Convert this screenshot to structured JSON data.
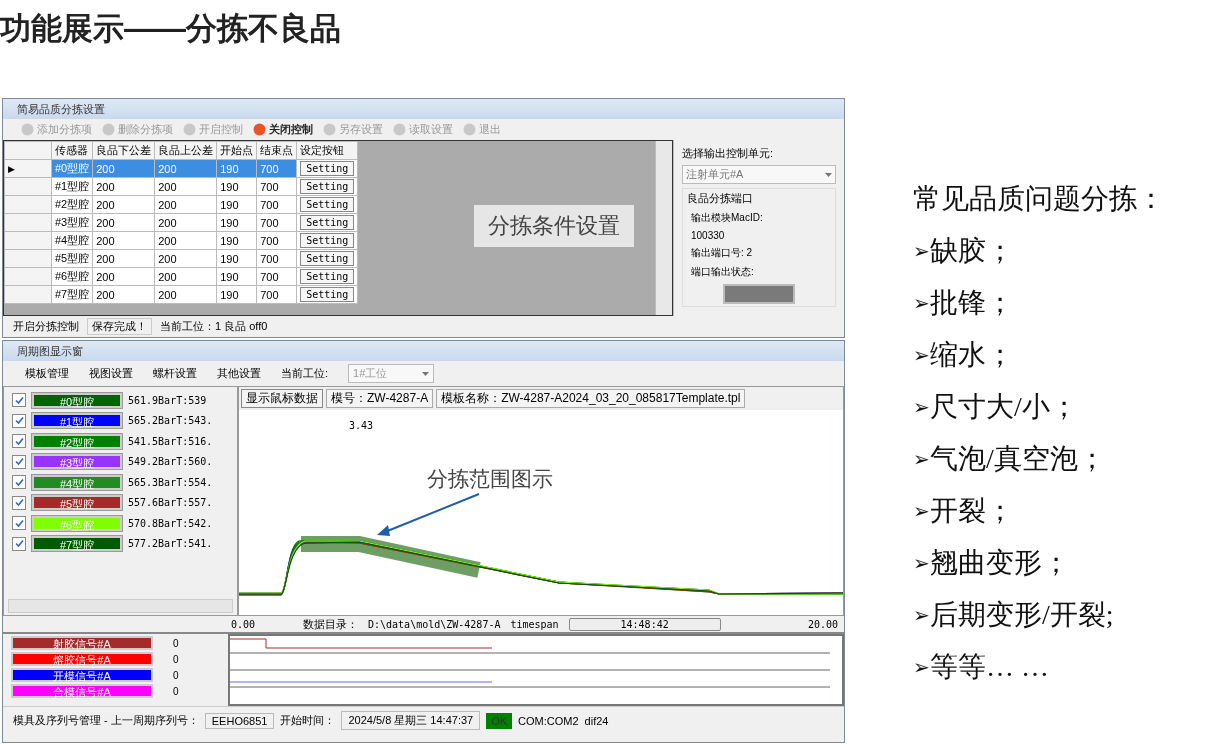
{
  "title": "功能展示——分拣不良品",
  "settings_window": {
    "title": "简易品质分拣设置",
    "toolbar": [
      {
        "label": "添加分拣项",
        "disabled": true
      },
      {
        "label": "删除分拣项",
        "disabled": true
      },
      {
        "label": "开启控制",
        "disabled": true
      },
      {
        "label": "关闭控制",
        "disabled": false
      },
      {
        "label": "另存设置",
        "disabled": true
      },
      {
        "label": "读取设置",
        "disabled": true
      },
      {
        "label": "退出",
        "disabled": true
      }
    ],
    "table": {
      "columns": [
        "传感器",
        "良品下公差",
        "良品上公差",
        "开始点",
        "结束点",
        "设定按钮"
      ],
      "rows": [
        {
          "selected": true,
          "current": "▶",
          "cells": [
            "#0型腔",
            "200",
            "200",
            "190",
            "700"
          ],
          "button": "Setting"
        },
        {
          "selected": false,
          "cells": [
            "#1型腔",
            "200",
            "200",
            "190",
            "700"
          ],
          "button": "Setting"
        },
        {
          "selected": false,
          "cells": [
            "#2型腔",
            "200",
            "200",
            "190",
            "700"
          ],
          "button": "Setting"
        },
        {
          "selected": false,
          "cells": [
            "#3型腔",
            "200",
            "200",
            "190",
            "700"
          ],
          "button": "Setting"
        },
        {
          "selected": false,
          "cells": [
            "#4型腔",
            "200",
            "200",
            "190",
            "700"
          ],
          "button": "Setting"
        },
        {
          "selected": false,
          "cells": [
            "#5型腔",
            "200",
            "200",
            "190",
            "700"
          ],
          "button": "Setting"
        },
        {
          "selected": false,
          "cells": [
            "#6型腔",
            "200",
            "200",
            "190",
            "700"
          ],
          "button": "Setting"
        },
        {
          "selected": false,
          "cells": [
            "#7型腔",
            "200",
            "200",
            "190",
            "700"
          ],
          "button": "Setting"
        }
      ]
    },
    "overlay_label": "分拣条件设置",
    "status": [
      "开启分拣控制",
      "保存完成！",
      "当前工位：1  良品  off0"
    ],
    "output_panel": {
      "heading": "选择输出控制单元:",
      "unit_select": "注射单元#A",
      "group_title": "良品分拣端口",
      "module_label": "输出模块MacID:",
      "module_value": "100330",
      "port_label": "输出端口号:  2",
      "state_label": "端口输出状态:"
    }
  },
  "monitor_window": {
    "title": "周期图显示窗",
    "menu": [
      "模板管理",
      "视图设置",
      "螺杆设置",
      "其他设置"
    ],
    "station_label": "当前工位:",
    "station_select": "1#工位",
    "cavities": [
      {
        "checked": true,
        "label": "#0型腔",
        "color": "#006400",
        "reading": "561.9BarT:539"
      },
      {
        "checked": true,
        "label": "#1型腔",
        "color": "#0000ff",
        "reading": "565.2BarT:543."
      },
      {
        "checked": true,
        "label": "#2型腔",
        "color": "#008000",
        "reading": "541.5BarT:516."
      },
      {
        "checked": true,
        "label": "#3型腔",
        "color": "#9933ff",
        "reading": "549.2BarT:560."
      },
      {
        "checked": true,
        "label": "#4型腔",
        "color": "#228b22",
        "reading": "565.3BarT:554."
      },
      {
        "checked": true,
        "label": "#5型腔",
        "color": "#a52a2a",
        "reading": "557.6BarT:557."
      },
      {
        "checked": true,
        "label": "#6型腔",
        "color": "#7fff00",
        "reading": "570.8BarT:542."
      },
      {
        "checked": true,
        "label": "#7型腔",
        "color": "#005a00",
        "reading": "577.2BarT:541."
      }
    ],
    "info_bar": [
      "显示鼠标数据",
      "模号：ZW-4287-A",
      "模板名称：ZW-4287-A2024_03_20_085817Template.tpl"
    ],
    "chart": {
      "cursor_value": "3.43",
      "annotation": "分拣范围图示"
    },
    "axis_bar": {
      "start": "0.00",
      "dir_label": "数据目录：",
      "dir_value": "D:\\data\\mold\\ZW-4287-A",
      "span_label": "timespan",
      "time": "14:48:42",
      "end": "20.00"
    },
    "signals": [
      {
        "label": "射胶信号#A",
        "color": "#a52a2a",
        "value": "0"
      },
      {
        "label": "熔胶信号#A",
        "color": "#ff0000",
        "value": "0"
      },
      {
        "label": "开模信号#A",
        "color": "#0000ff",
        "value": "0"
      },
      {
        "label": "合模信号#A",
        "color": "#ff00ff",
        "value": "0"
      }
    ],
    "status": {
      "label": "模具及序列号管理 - 上一周期序列号：",
      "serial": "EEHO6851",
      "start_label": "开始时间：",
      "start_time": "2024/5/8 星期三 14:47:37",
      "ok": "OK",
      "port": "COM:COM2",
      "code": "dif24"
    }
  },
  "issues": {
    "heading": "常见品质问题分拣：",
    "items": [
      {
        "marker": "➢",
        "text": "缺胶；"
      },
      {
        "marker": "➢",
        "text": "批锋；"
      },
      {
        "marker": "➢",
        "text": "缩水；"
      },
      {
        "marker": "➢",
        "text": "尺寸大/小；"
      },
      {
        "marker": "➢",
        "text": "气泡/真空泡；"
      },
      {
        "marker": "➢",
        "text": "开裂；"
      },
      {
        "marker": "➢",
        "text": "翘曲变形；"
      },
      {
        "marker": "➢",
        "text": "后期变形/开裂;"
      },
      {
        "marker": "➢",
        "text": "等等… …"
      }
    ]
  }
}
